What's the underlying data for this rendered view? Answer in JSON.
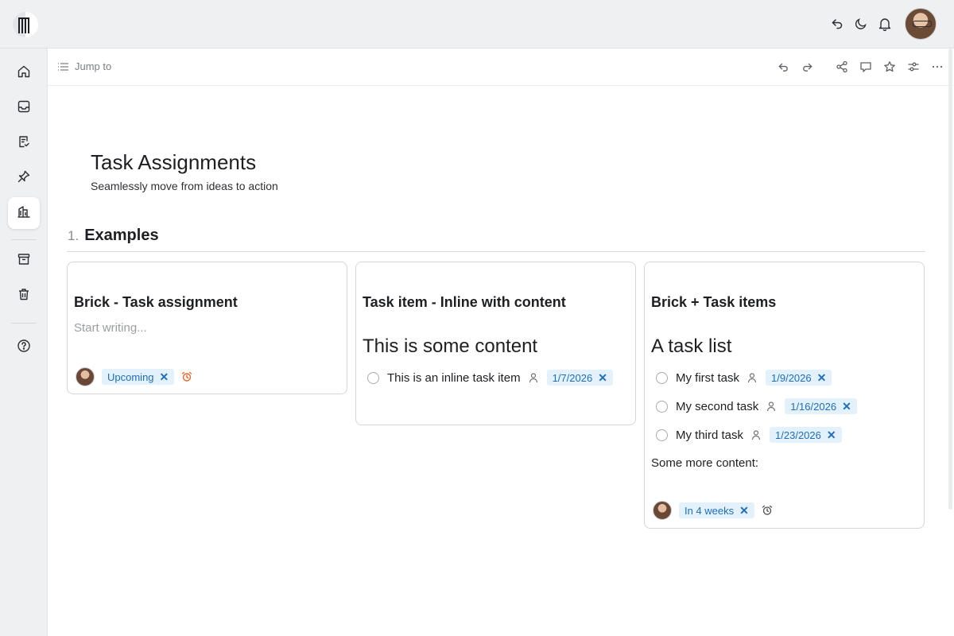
{
  "colors": {
    "accent_chip_bg": "#e3f1fd",
    "accent_chip_text": "#1f6fb8",
    "alarm_orange": "#e8692c",
    "sidebar_bg": "#eef0f2"
  },
  "topbar": {
    "icons": [
      "logo-icon",
      "undo-back-icon",
      "moon-icon",
      "bell-icon",
      "user-avatar"
    ]
  },
  "sidebar": {
    "items": [
      {
        "icon": "home-icon"
      },
      {
        "icon": "inbox-icon"
      },
      {
        "icon": "checklist-icon"
      },
      {
        "icon": "pin-icon"
      },
      {
        "icon": "buildings-icon",
        "active": true
      },
      {
        "icon": "archive-icon"
      },
      {
        "icon": "trash-icon"
      },
      {
        "icon": "help-icon"
      }
    ]
  },
  "subbar": {
    "jump_label": "Jump to",
    "icons": [
      "undo-icon",
      "redo-icon",
      "share-icon",
      "comment-icon",
      "star-icon",
      "settings-sliders-icon",
      "more-icon"
    ]
  },
  "page": {
    "title": "Task Assignments",
    "subtitle": "Seamlessly move from ideas to action"
  },
  "section": {
    "number": "1.",
    "title": "Examples"
  },
  "cards": [
    {
      "title": "Brick - Task assignment",
      "placeholder": "Start writing...",
      "chip": "Upcoming"
    },
    {
      "title": "Task item - Inline with content",
      "heading": "This is some content",
      "task": {
        "text": "This is an inline task item",
        "date": "1/7/2026"
      }
    },
    {
      "title": "Brick + Task items",
      "heading": "A task list",
      "tasks": [
        {
          "text": "My first task",
          "date": "1/9/2026"
        },
        {
          "text": "My second task",
          "date": "1/16/2026"
        },
        {
          "text": "My third task",
          "date": "1/23/2026"
        }
      ],
      "more": "Some more content:",
      "chip": "In 4 weeks"
    }
  ]
}
